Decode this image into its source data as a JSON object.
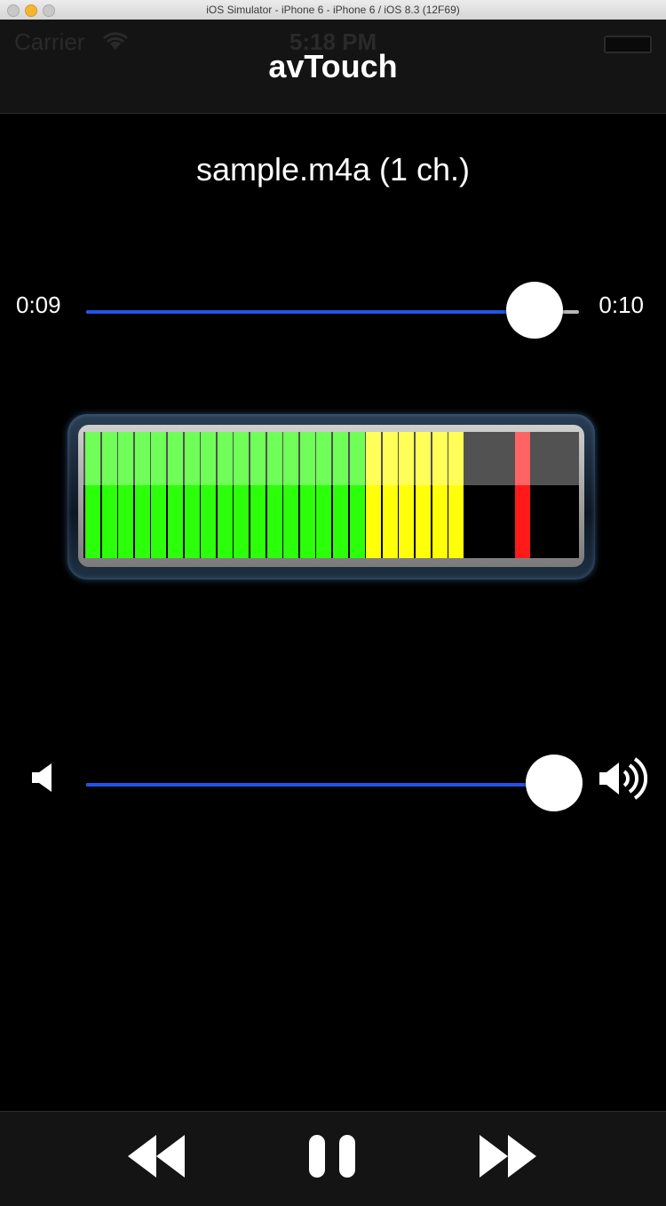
{
  "window": {
    "title": "iOS Simulator - iPhone 6 - iPhone 6 / iOS 8.3 (12F69)"
  },
  "status_bar": {
    "carrier": "Carrier",
    "time": "5:18 PM"
  },
  "nav": {
    "title": "avTouch"
  },
  "file": {
    "label": "sample.m4a (1 ch.)"
  },
  "progress": {
    "current": "0:09",
    "duration": "0:10",
    "fraction": 0.91
  },
  "meter": {
    "segments_total": 30,
    "lit_green": 17,
    "lit_yellow": 6,
    "peak_segment": 26
  },
  "volume": {
    "fraction": 0.95
  },
  "toolbar": {
    "rewind_icon": "rewind-icon",
    "pause_icon": "pause-icon",
    "fast_forward_icon": "fast-forward-icon"
  },
  "colors": {
    "accent": "#1f55e6",
    "meter_green": "#2cff0a",
    "meter_yellow": "#ffff0a",
    "meter_peak": "#ff1a1a"
  }
}
